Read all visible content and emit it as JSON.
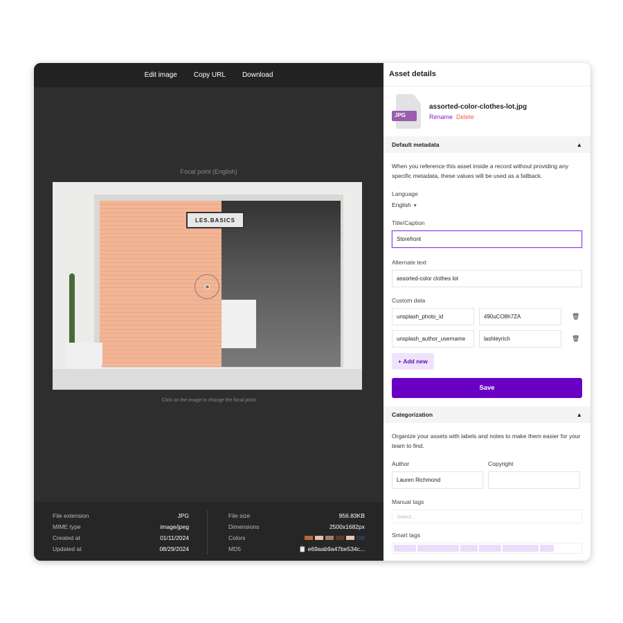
{
  "toolbar": {
    "edit": "Edit image",
    "copy": "Copy URL",
    "download": "Download"
  },
  "preview": {
    "focal_label": "Focal point (English)",
    "sign": "LES.BASICS",
    "hint": "Click on the image to change the focal point"
  },
  "info": {
    "left": [
      {
        "k": "File extension",
        "v": "JPG"
      },
      {
        "k": "MIME type",
        "v": "image/jpeg"
      },
      {
        "k": "Created at",
        "v": "01/11/2024"
      },
      {
        "k": "Updated at",
        "v": "08/29/2024"
      }
    ],
    "file_size_label": "File size",
    "file_size": "956.83KB",
    "dimensions_label": "Dimensions",
    "dimensions": "2500x1682px",
    "colors_label": "Colors",
    "colors": [
      "#b8693a",
      "#e6c0b0",
      "#a87c6b",
      "#5c3a30",
      "#e8c4b4",
      "#2a3a4c"
    ],
    "md5_label": "MD5",
    "md5": "e69aab9a47be534c..."
  },
  "panel": {
    "title": "Asset details",
    "file_badge": "JPG",
    "filename": "assorted-color-clothes-lot.jpg",
    "rename": "Rename",
    "delete": "Delete",
    "default_metadata": "Default metadata",
    "default_desc": "When you reference this asset inside a record without providing any specific metadata, these values will be used as a fallback.",
    "language_label": "Language",
    "language": "English",
    "title_label": "Title/Caption",
    "title_value": "Storefront",
    "alt_label": "Alternate text",
    "alt_value": "assorted-color clothes lot",
    "custom_label": "Custom data",
    "custom": [
      {
        "k": "unsplash_photo_id",
        "v": "490uCO8h7ZA"
      },
      {
        "k": "unsplash_author_username",
        "v": "lashleyrich"
      }
    ],
    "add_new": "Add new",
    "save": "Save",
    "categorization": "Categorization",
    "cat_desc": "Organize your assets with labels and notes to make them easier for your team to find.",
    "author_label": "Author",
    "author": "Lauren Richmond",
    "copyright_label": "Copyright",
    "copyright": "",
    "manual_tags_label": "Manual tags",
    "manual_tags_placeholder": "Select...",
    "smart_tags_label": "Smart tags"
  },
  "accent": "#6a00c4"
}
